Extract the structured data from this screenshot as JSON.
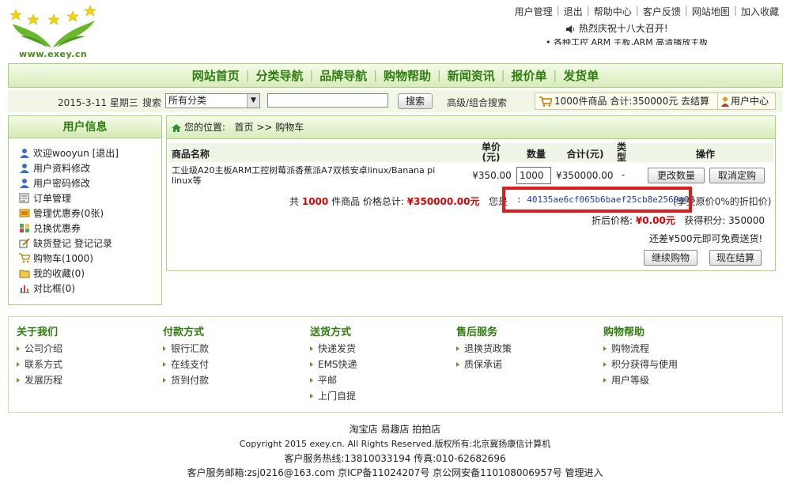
{
  "logo": {
    "text": "www.exey.cn"
  },
  "top_links": [
    "用户管理",
    "退出",
    "帮助中心",
    "客户反馈",
    "网站地图",
    "加入收藏"
  ],
  "notice": {
    "line1": "热烈庆祝十八大召开!",
    "line2": "• 各种工控 ARM 主板,ARM 高清播放主板"
  },
  "nav": [
    "网站首页",
    "分类导航",
    "品牌导航",
    "购物帮助",
    "新闻资讯",
    "报价单",
    "发货单"
  ],
  "search": {
    "date": "2015-3-11 星期三",
    "label": "搜索",
    "category": "所有分类",
    "input_value": "",
    "button": "搜索",
    "advanced": "高级/组合搜索"
  },
  "cart_summary": {
    "text": "1000件商品 合计:350000元",
    "checkout": "去结算"
  },
  "user_center": "用户中心",
  "sidebar": {
    "title": "用户信息",
    "items": [
      {
        "label": "欢迎wooyun [退出]",
        "icon": "user-icon"
      },
      {
        "label": "用户资料修改",
        "icon": "user-icon"
      },
      {
        "label": "用户密码修改",
        "icon": "user-icon"
      },
      {
        "label": "订单管理",
        "icon": "order-icon"
      },
      {
        "label": "管理优惠券(0张)",
        "icon": "coupon-icon"
      },
      {
        "label": "兑换优惠券",
        "icon": "exchange-icon"
      },
      {
        "label": "缺货登记  登记记录",
        "icon": "edit-icon"
      },
      {
        "label": "购物车(1000)",
        "icon": "cart-icon"
      },
      {
        "label": "我的收藏(0)",
        "icon": "folder-icon"
      },
      {
        "label": "对比框(0)",
        "icon": "chart-icon"
      }
    ]
  },
  "breadcrumb": {
    "prefix": "您的位置:",
    "home": "首页",
    "sep": ">>",
    "current": "购物车"
  },
  "cart_table": {
    "headers": {
      "name": "商品名称",
      "price": "单价\n(元)",
      "qty": "数量",
      "total": "合计(元)",
      "type": "类型",
      "ops": "操作"
    },
    "rows": [
      {
        "name": "工业级A20主板ARM工控树莓派香蕉派A7双核安卓linux/Banana pi linux等",
        "price": "¥350.00",
        "qty": "1000",
        "total": "¥350000.00",
        "type": "-",
        "update_button": "更改数量",
        "cancel_button": "取消定购"
      }
    ],
    "summary_prefix": "共",
    "summary_count": "1000",
    "summary_mid": "件商品 价格总计:",
    "summary_total": "¥350000.00元",
    "coupon_label": "您是",
    "coupon_code": ": 40135ae6cf065b6baef25cb8e2569a05",
    "coupon_note": "(享受原价0%的折扣价)",
    "discount_label": "折后价格:",
    "discount_value": "¥0.00元",
    "points_label": "获得积分:",
    "points_value": "350000",
    "shipping_note": "还差¥500元即可免费送货!",
    "continue_button": "继续购物",
    "checkout_button": "现在结算"
  },
  "footer": {
    "columns": [
      {
        "title": "关于我们",
        "items": [
          "公司介绍",
          "联系方式",
          "发展历程"
        ]
      },
      {
        "title": "付款方式",
        "items": [
          "银行汇款",
          "在线支付",
          "货到付款"
        ]
      },
      {
        "title": "送货方式",
        "items": [
          "快递发货",
          "EMS快递",
          "平邮",
          "上门自提"
        ]
      },
      {
        "title": "售后服务",
        "items": [
          "退换货政策",
          "质保承诺"
        ]
      },
      {
        "title": "购物帮助",
        "items": [
          "购物流程",
          "积分获得与使用",
          "用户等级"
        ]
      }
    ]
  },
  "bottom": {
    "shops": "淘宝店  易趣店  拍拍店",
    "copyright": "Copyright 2015 exey.cn. All Rights Reserved.版权所有:北京冀扬康信计算机",
    "hotline": "客户服务热线:13810033194  传真:010-62682696",
    "email": "客户服务邮箱:zsj0216@163.com 京ICP备11024207号 京公网安备110108006957号 管理进入"
  },
  "colors": {
    "accent_green": "#2f7d10",
    "price_red": "#d00000",
    "highlight_red": "#e01b1b",
    "link_blue": "#1a3ea8"
  }
}
